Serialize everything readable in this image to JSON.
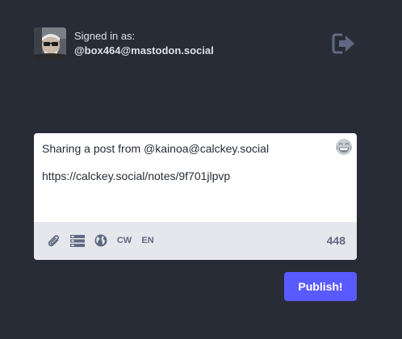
{
  "account": {
    "signed_in_label": "Signed in as:",
    "handle": "@box464@mastodon.social",
    "avatar": "avatar-photo"
  },
  "header": {
    "logout_icon": "sign-out-icon"
  },
  "composer": {
    "text": "Sharing a post from @kainoa@calckey.social\n\nhttps://calckey.social/notes/9f701jlpvp",
    "emoji_icon": "emoji-grinning-icon",
    "toolbar": {
      "attach_icon": "paperclip-icon",
      "poll_icon": "poll-icon",
      "privacy_icon": "globe-icon",
      "cw_label": "CW",
      "language_label": "EN",
      "char_count": "448"
    }
  },
  "actions": {
    "publish_label": "Publish!"
  },
  "colors": {
    "background": "#282c37",
    "accent": "#595aff",
    "toolbar": "#e6e7ec",
    "icon": "#606984"
  }
}
